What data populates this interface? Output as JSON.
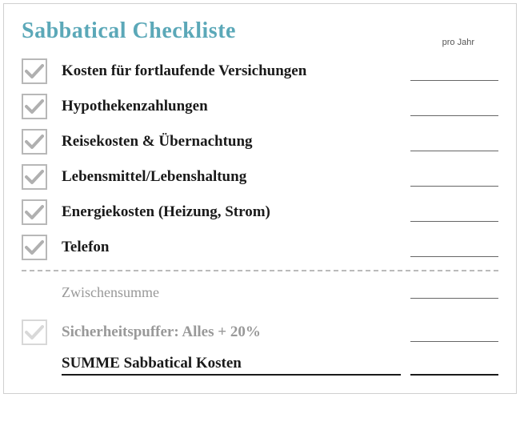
{
  "title": "Sabbatical Checkliste",
  "per_year_label": "pro Jahr",
  "items": [
    {
      "label": "Kosten für fortlaufende Versichungen"
    },
    {
      "label": "Hypothekenzahlungen"
    },
    {
      "label": "Reisekosten & Übernachtung"
    },
    {
      "label": "Lebensmittel/Lebenshaltung"
    },
    {
      "label": "Energiekosten (Heizung, Strom)"
    },
    {
      "label": "Telefon"
    }
  ],
  "subtotal_label": "Zwischensumme",
  "buffer_label": "Sicherheitspuffer: Alles + 20%",
  "total_label": "SUMME Sabbatical Kosten"
}
